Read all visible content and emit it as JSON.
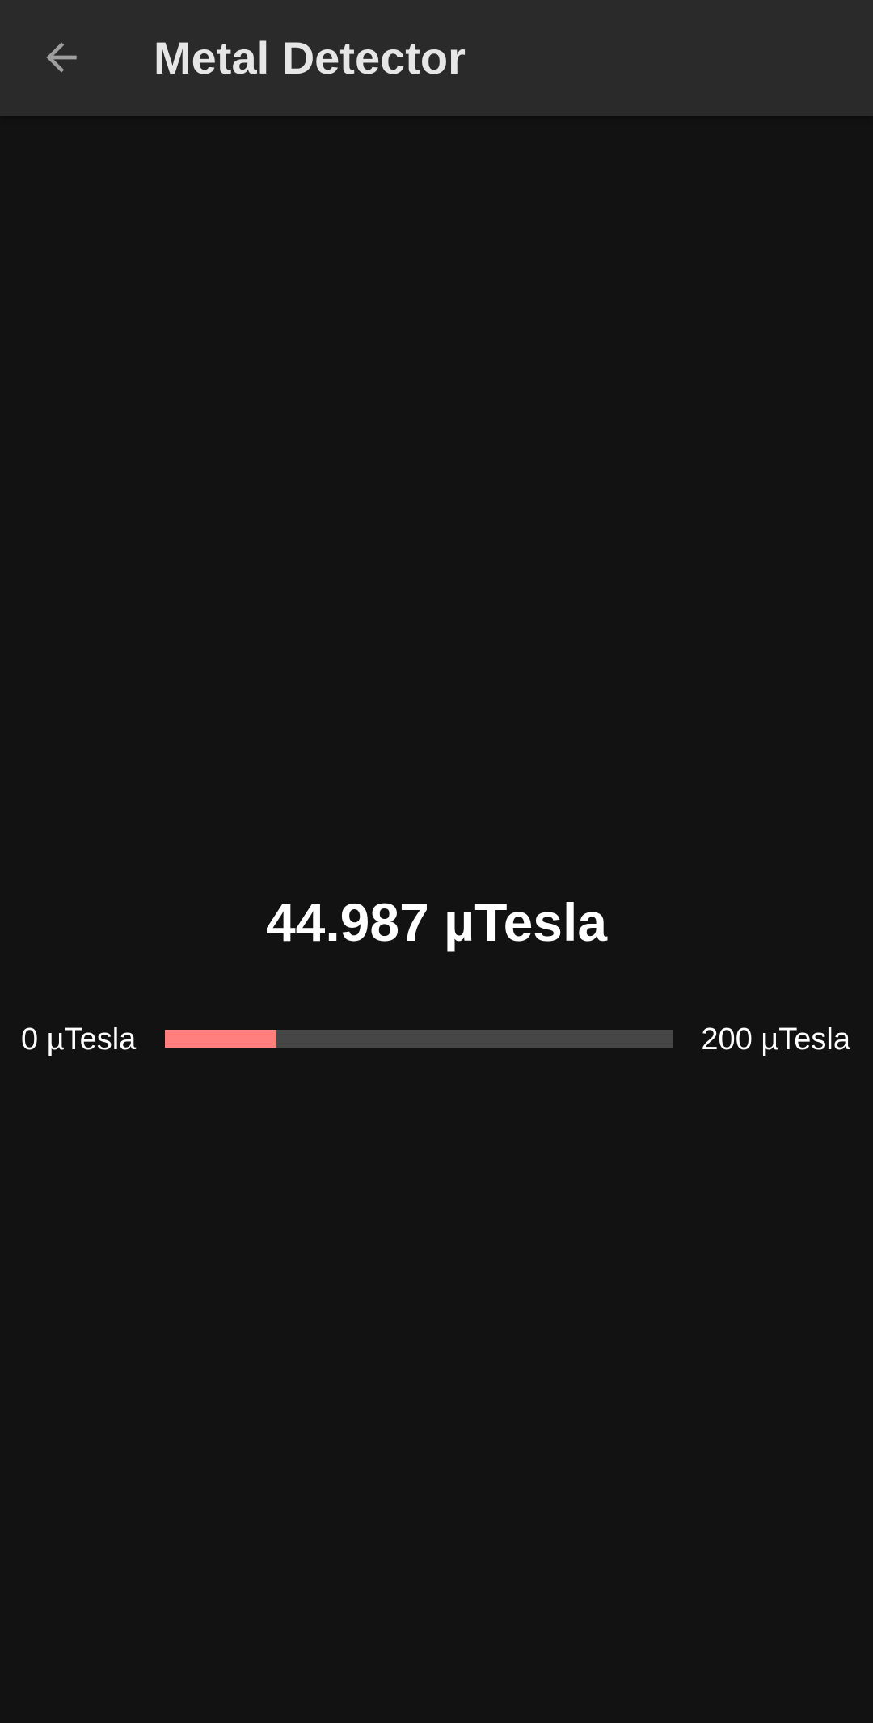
{
  "app_bar": {
    "title": "Metal Detector",
    "back_icon": "arrow-back-icon"
  },
  "reading": {
    "value_text": "44.987 µTesla"
  },
  "meter": {
    "min_label": "0 µTesla",
    "max_label": "200 µTesla",
    "fill_fraction": 0.22,
    "fill_color": "#ff7f7f",
    "track_color": "#464646"
  },
  "colors": {
    "background": "#121212",
    "app_bar": "#2a2a2a",
    "title_text": "#e6e6e6"
  }
}
